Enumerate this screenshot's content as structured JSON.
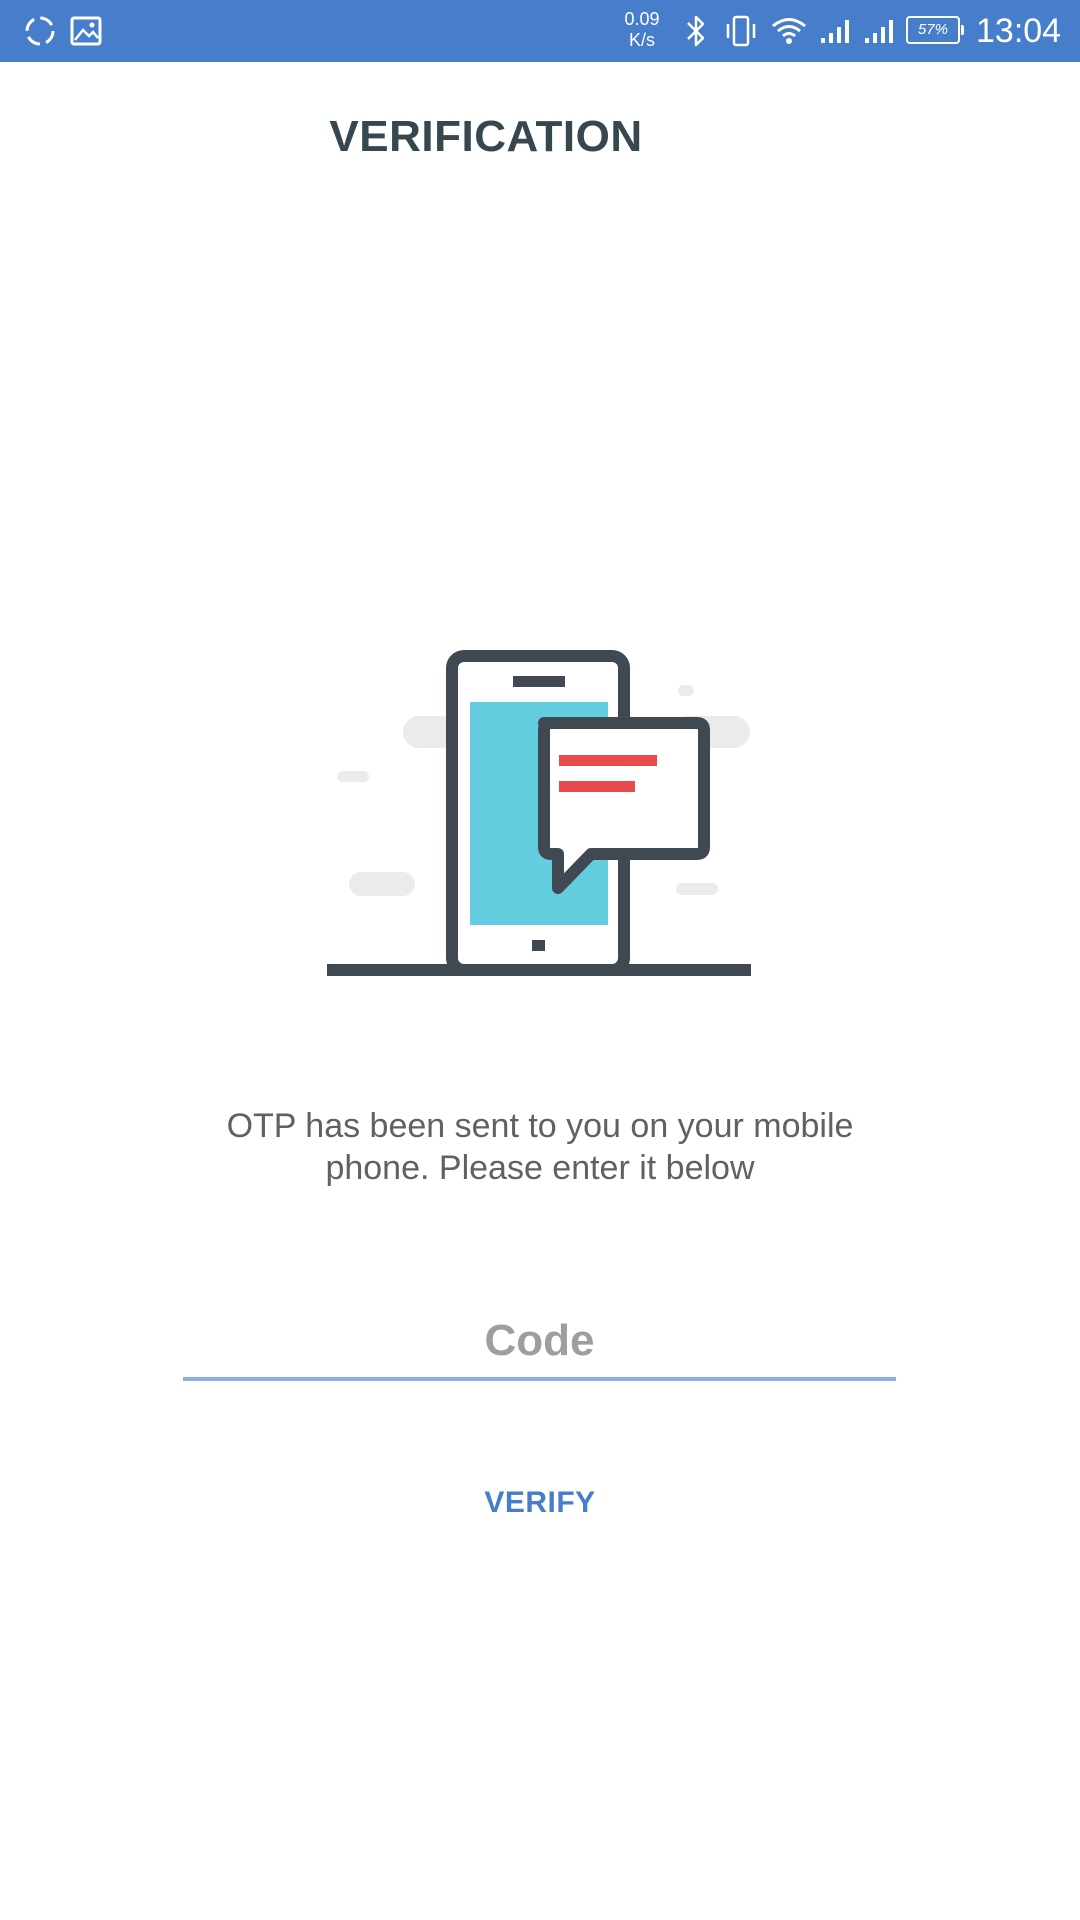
{
  "status_bar": {
    "network_speed_value": "0.09",
    "network_speed_unit": "K/s",
    "battery_percent": "57%",
    "time": "13:04",
    "left_icons": [
      "sync-icon",
      "image-icon"
    ],
    "right_icons": [
      "bluetooth-icon",
      "vibrate-icon",
      "wifi-icon",
      "signal-icon",
      "signal-icon"
    ],
    "background_color": "#477ecb"
  },
  "header": {
    "title": "VERIFICATION"
  },
  "illustration": {
    "icon": "phone-message-illustration",
    "colors": {
      "outline": "#404852",
      "screen": "#64cde0",
      "message_lines": "#e84a4d",
      "clouds": "#ebebeb"
    }
  },
  "main": {
    "message_line_1": "OTP has been sent to you on your mobile",
    "message_line_2": "phone. Please enter it below",
    "code_input": {
      "placeholder": "Code",
      "value": ""
    },
    "verify_label": "VERIFY",
    "accent_color": "#477ecb"
  }
}
